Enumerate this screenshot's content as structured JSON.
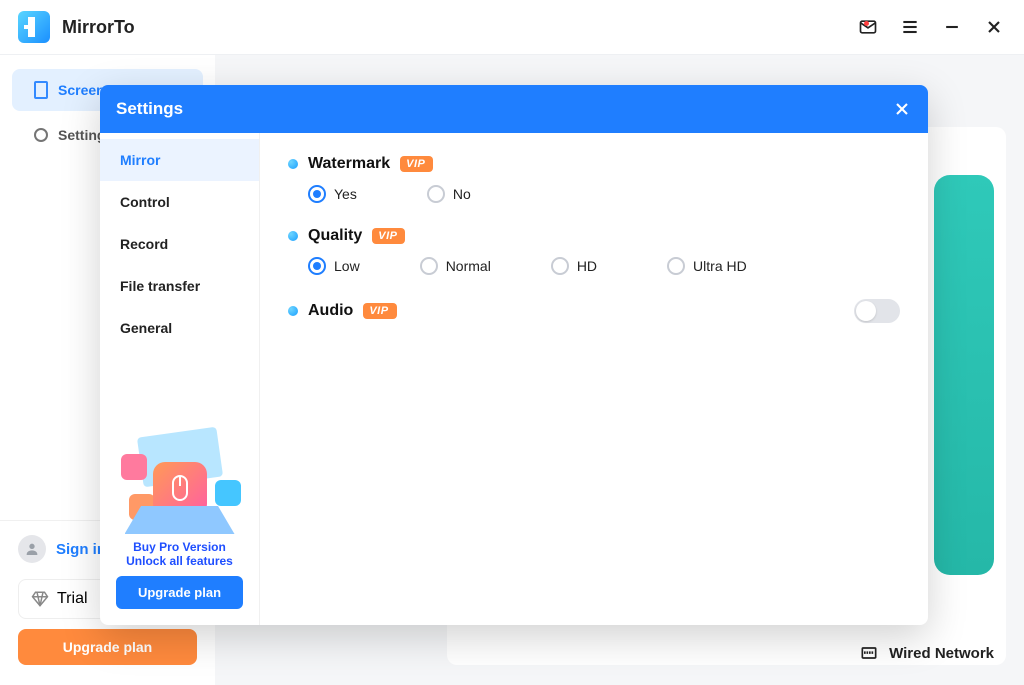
{
  "app": {
    "title": "MirrorTo"
  },
  "sidebar": {
    "items": [
      {
        "label": "Screen Mirror"
      },
      {
        "label": "Settings"
      }
    ],
    "signin": "Sign in",
    "plan": "Trial",
    "upgrade": "Upgrade plan"
  },
  "footer": {
    "network": "Wired Network"
  },
  "modal": {
    "title": "Settings",
    "nav": [
      "Mirror",
      "Control",
      "Record",
      "File transfer",
      "General"
    ],
    "promo": {
      "line1": "Buy Pro Version",
      "line2": "Unlock all features",
      "button": "Upgrade plan"
    },
    "settings": {
      "watermark": {
        "title": "Watermark",
        "badge": "VIP",
        "options": [
          "Yes",
          "No"
        ],
        "selected": "Yes"
      },
      "quality": {
        "title": "Quality",
        "badge": "VIP",
        "options": [
          "Low",
          "Normal",
          "HD",
          "Ultra HD"
        ],
        "selected": "Low"
      },
      "audio": {
        "title": "Audio",
        "badge": "VIP",
        "enabled": false
      }
    }
  }
}
